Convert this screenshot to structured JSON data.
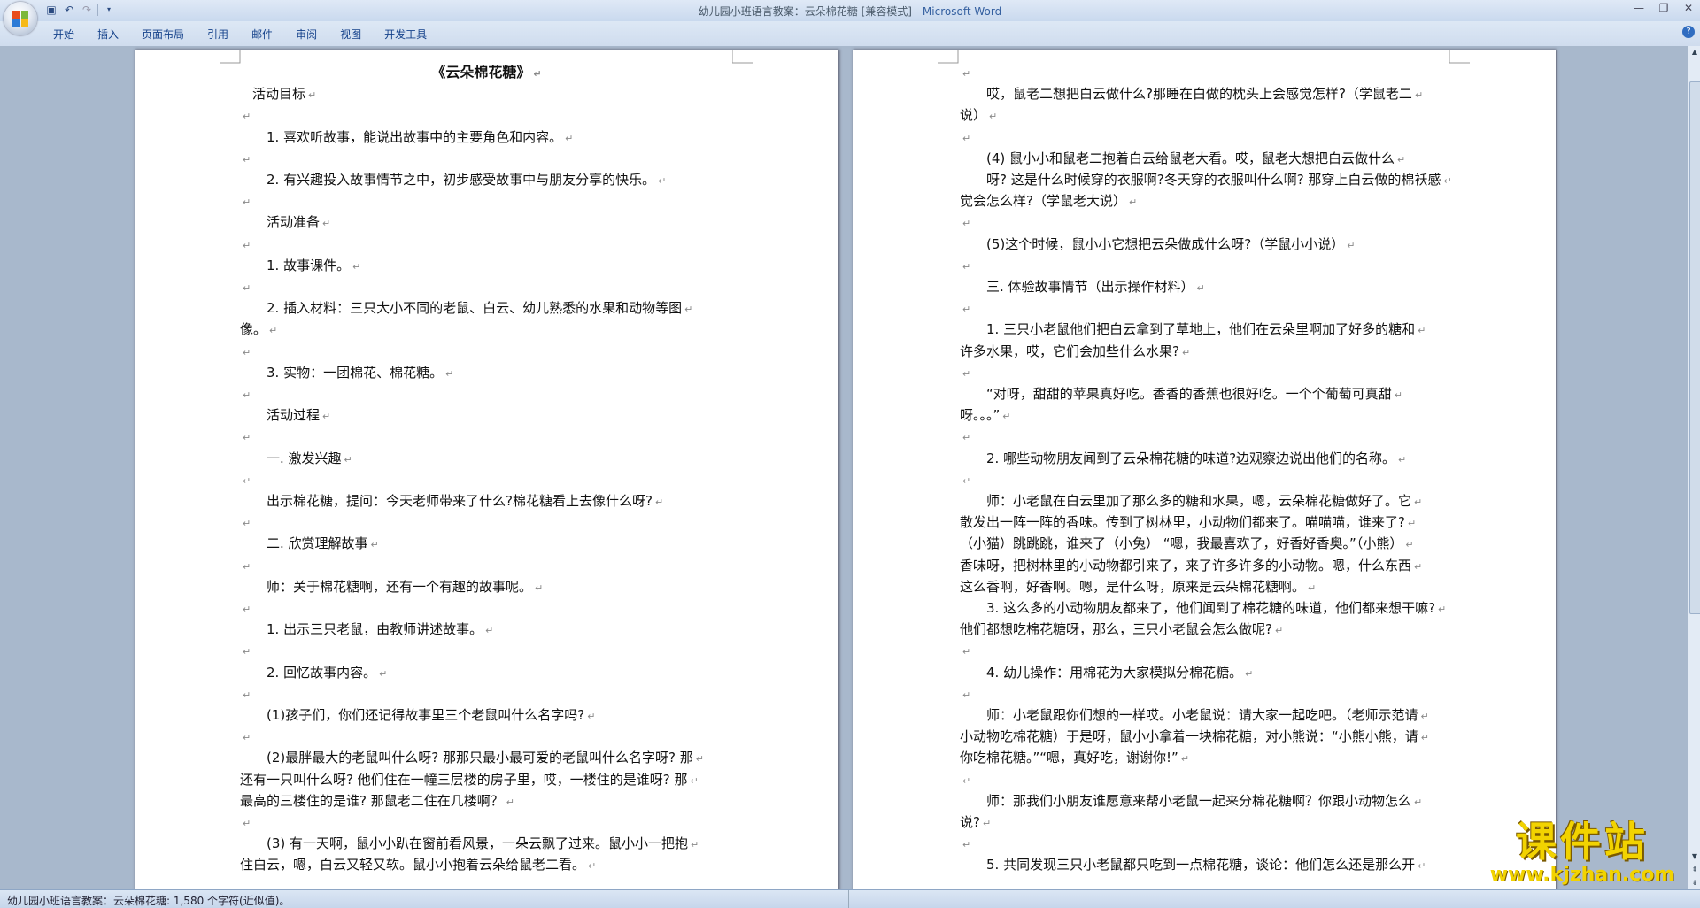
{
  "window": {
    "title_doc": "幼儿园小班语言教案：云朵棉花糖 [兼容模式] - ",
    "title_app": "Microsoft Word"
  },
  "ribbon": {
    "tabs": [
      "开始",
      "插入",
      "页面布局",
      "引用",
      "邮件",
      "审阅",
      "视图",
      "开发工具"
    ]
  },
  "document": {
    "left_page": [
      "《云朵棉花糖》",
      "活动目标",
      "",
      "1. 喜欢听故事，能说出故事中的主要角色和内容。",
      "",
      "2. 有兴趣投入故事情节之中，初步感受故事中与朋友分享的快乐。",
      "",
      "活动准备",
      "",
      "1. 故事课件。",
      "",
      "2. 插入材料：三只大小不同的老鼠、白云、幼儿熟悉的水果和动物等图",
      "像。",
      "",
      "3. 实物：一团棉花、棉花糖。",
      "",
      "活动过程",
      "",
      "一. 激发兴趣",
      "",
      "出示棉花糖，提问：今天老师带来了什么?棉花糖看上去像什么呀?",
      "",
      "二. 欣赏理解故事",
      "",
      "师：关于棉花糖啊，还有一个有趣的故事呢。",
      "",
      "1. 出示三只老鼠，由教师讲述故事。",
      "",
      "2. 回忆故事内容。",
      "",
      "(1)孩子们，你们还记得故事里三个老鼠叫什么名字吗?",
      "",
      "(2)最胖最大的老鼠叫什么呀? 那那只最小最可爱的老鼠叫什么名字呀? 那",
      "还有一只叫什么呀? 他们住在一幢三层楼的房子里，哎，一楼住的是谁呀? 那",
      "最高的三楼住的是谁? 那鼠老二住在几楼啊？",
      "",
      "(3) 有一天啊，鼠小小趴在窗前看风景，一朵云飘了过来。鼠小小一把抱",
      "住白云，嗯，白云又轻又软。鼠小小抱着云朵给鼠老二看。"
    ],
    "right_page": [
      "",
      "哎，鼠老二想把白云做什么?那睡在白做的枕头上会感觉怎样?（学鼠老二",
      "说）",
      "",
      "(4) 鼠小小和鼠老二抱着白云给鼠老大看。哎，鼠老大想把白云做什么",
      "呀? 这是什么时候穿的衣服啊?冬天穿的衣服叫什么啊? 那穿上白云做的棉袄感",
      "觉会怎么样?（学鼠老大说）",
      "",
      "(5)这个时候，鼠小小它想把云朵做成什么呀?（学鼠小小说）",
      "",
      "三. 体验故事情节（出示操作材料）",
      "",
      "1. 三只小老鼠他们把白云拿到了草地上，他们在云朵里啊加了好多的糖和",
      "许多水果，哎，它们会加些什么水果?",
      "",
      "“对呀，甜甜的苹果真好吃。香香的香蕉也很好吃。一个个葡萄可真甜",
      "呀。。。”",
      "",
      "2. 哪些动物朋友闻到了云朵棉花糖的味道?边观察边说出他们的名称。",
      "",
      "师：小老鼠在白云里加了那么多的糖和水果，嗯，云朵棉花糖做好了。它",
      "散发出一阵一阵的香味。传到了树林里，小动物们都来了。喵喵喵，谁来了?",
      "（小猫）跳跳跳，谁来了（小兔） “嗯，我最喜欢了，好香好香奥。”（小熊）",
      "香味呀，把树林里的小动物都引来了，来了许多许多的小动物。嗯，什么东西",
      "这么香啊，好香啊。嗯，是什么呀，原来是云朵棉花糖啊。",
      "3. 这么多的小动物朋友都来了，他们闻到了棉花糖的味道，他们都来想干嘛?",
      "他们都想吃棉花糖呀，那么，三只小老鼠会怎么做呢?",
      "",
      "4. 幼儿操作：用棉花为大家模拟分棉花糖。",
      "",
      "师：小老鼠跟你们想的一样哎。小老鼠说：请大家一起吃吧。（老师示范请",
      "小动物吃棉花糖）于是呀，鼠小小拿着一块棉花糖，对小熊说：“小熊小熊，请",
      "你吃棉花糖。”“嗯，真好吃，谢谢你!”",
      "",
      "师：那我们小朋友谁愿意来帮小老鼠一起来分棉花糖啊？你跟小动物怎么",
      "说?",
      "",
      "5. 共同发现三只小老鼠都只吃到一点棉花糖，谈论：他们怎么还是那么开"
    ]
  },
  "status": {
    "text": "幼儿园小班语言教案：云朵棉花糖: 1,580 个字符(近似值)。"
  },
  "watermark": {
    "main": "课件站",
    "url": "www.kjzhan.com"
  },
  "colors": {
    "ribbon_text": "#15428b",
    "doc_background": "#a8b8cc",
    "watermark": "#f2d300"
  }
}
